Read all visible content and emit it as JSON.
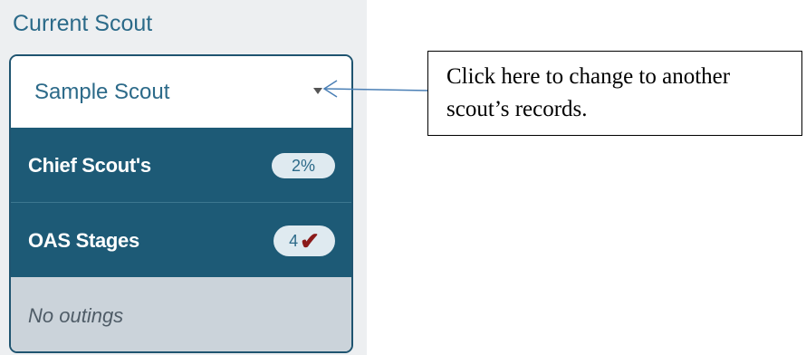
{
  "panel": {
    "title": "Current Scout",
    "selector": {
      "value": "Sample Scout",
      "caret_icon": "chevron-down-icon"
    },
    "rows": [
      {
        "label": "Chief Scout's",
        "badge": "2%"
      },
      {
        "label": "OAS Stages",
        "badge_count": "4",
        "badge_icon": "checkmark-icon",
        "badge_icon_glyph": "✔"
      }
    ],
    "outings": "No outings"
  },
  "callout": {
    "text": "Click here to change to another scout’s records."
  },
  "colors": {
    "brand_dark": "#1d5a76",
    "brand_text": "#2c6a89",
    "check_red": "#8b1a1a",
    "arrow": "#4a7fb5"
  }
}
